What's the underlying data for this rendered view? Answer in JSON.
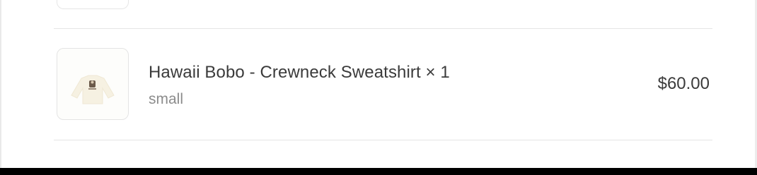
{
  "order_item": {
    "title": "Hawaii Bobo - Crewneck Sweatshirt × 1",
    "variant": "small",
    "price": "$60.00",
    "thumbnail_icon": "sweatshirt-image"
  },
  "colors": {
    "text_primary": "#3b3b3b",
    "text_secondary": "#8c8c8c",
    "divider": "#e5e5e5"
  }
}
